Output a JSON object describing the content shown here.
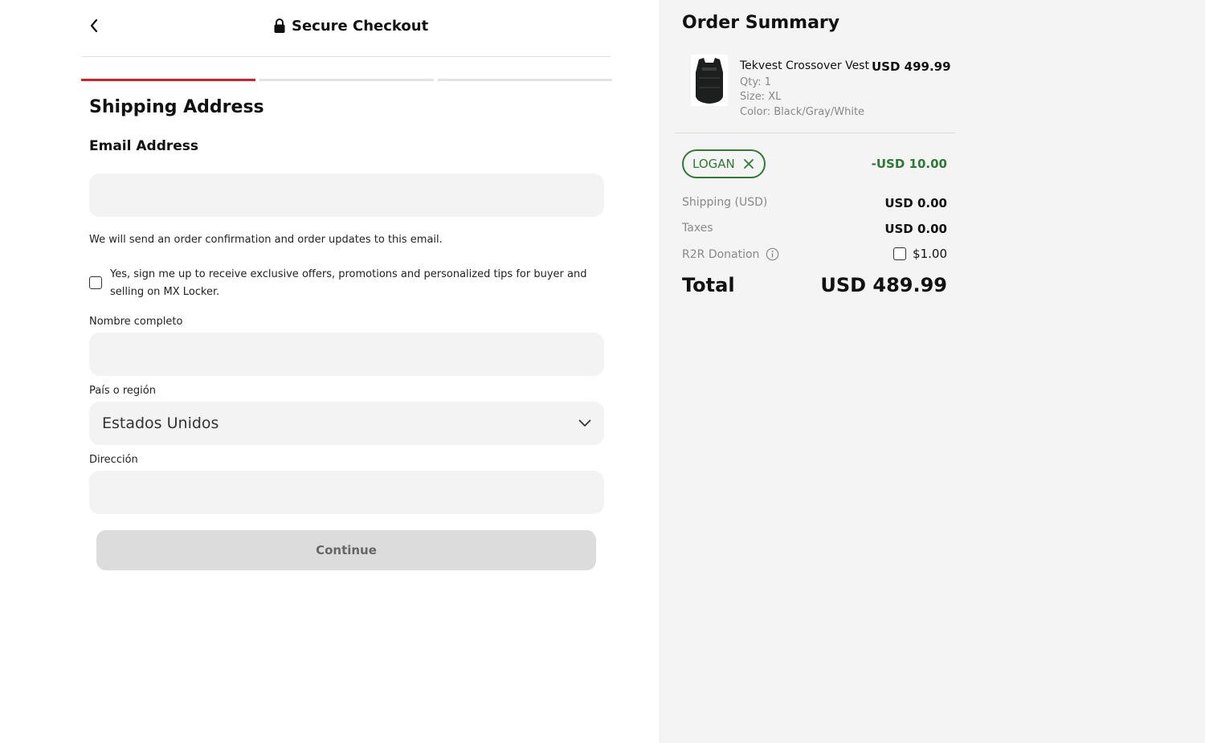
{
  "header": {
    "title": "Secure Checkout"
  },
  "progress": {
    "steps_total": 3,
    "active_step": 1
  },
  "form": {
    "section_title": "Shipping Address",
    "email_label": "Email Address",
    "email_value": "",
    "email_help": "We will send an order confirmation and order updates to this email.",
    "newsletter_text": "Yes, sign me up to receive exclusive offers, promotions and personalized tips for buyer and selling on MX Locker.",
    "newsletter_checked": false,
    "name_label": "Nombre completo",
    "name_value": "",
    "country_label": "País o región",
    "country_value": "Estados Unidos",
    "address_label": "Dirección",
    "address_value": "",
    "continue_label": "Continue"
  },
  "summary": {
    "title": "Order Summary",
    "product": {
      "name": "Tekvest Crossover Vest",
      "price": "USD 499.99",
      "qty": "Qty: 1",
      "size": "Size: XL",
      "color": "Color: Black/Gray/White"
    },
    "promo": {
      "code": "LOGAN",
      "discount": "-USD 10.00"
    },
    "shipping_label": "Shipping (USD)",
    "shipping_value": "USD 0.00",
    "taxes_label": "Taxes",
    "taxes_value": "USD 0.00",
    "donation_label": "R2R Donation",
    "donation_amount": "$1.00",
    "donation_checked": false,
    "total_label": "Total",
    "total_value": "USD 489.99"
  },
  "colors": {
    "accent": "#d0222a",
    "promo_green": "#2c7a34",
    "summary_bg": "#f4f4f4"
  },
  "icons": [
    "chevron-left-icon",
    "lock-icon",
    "chevron-down-icon",
    "close-icon",
    "info-icon",
    "vest-thumbnail"
  ]
}
